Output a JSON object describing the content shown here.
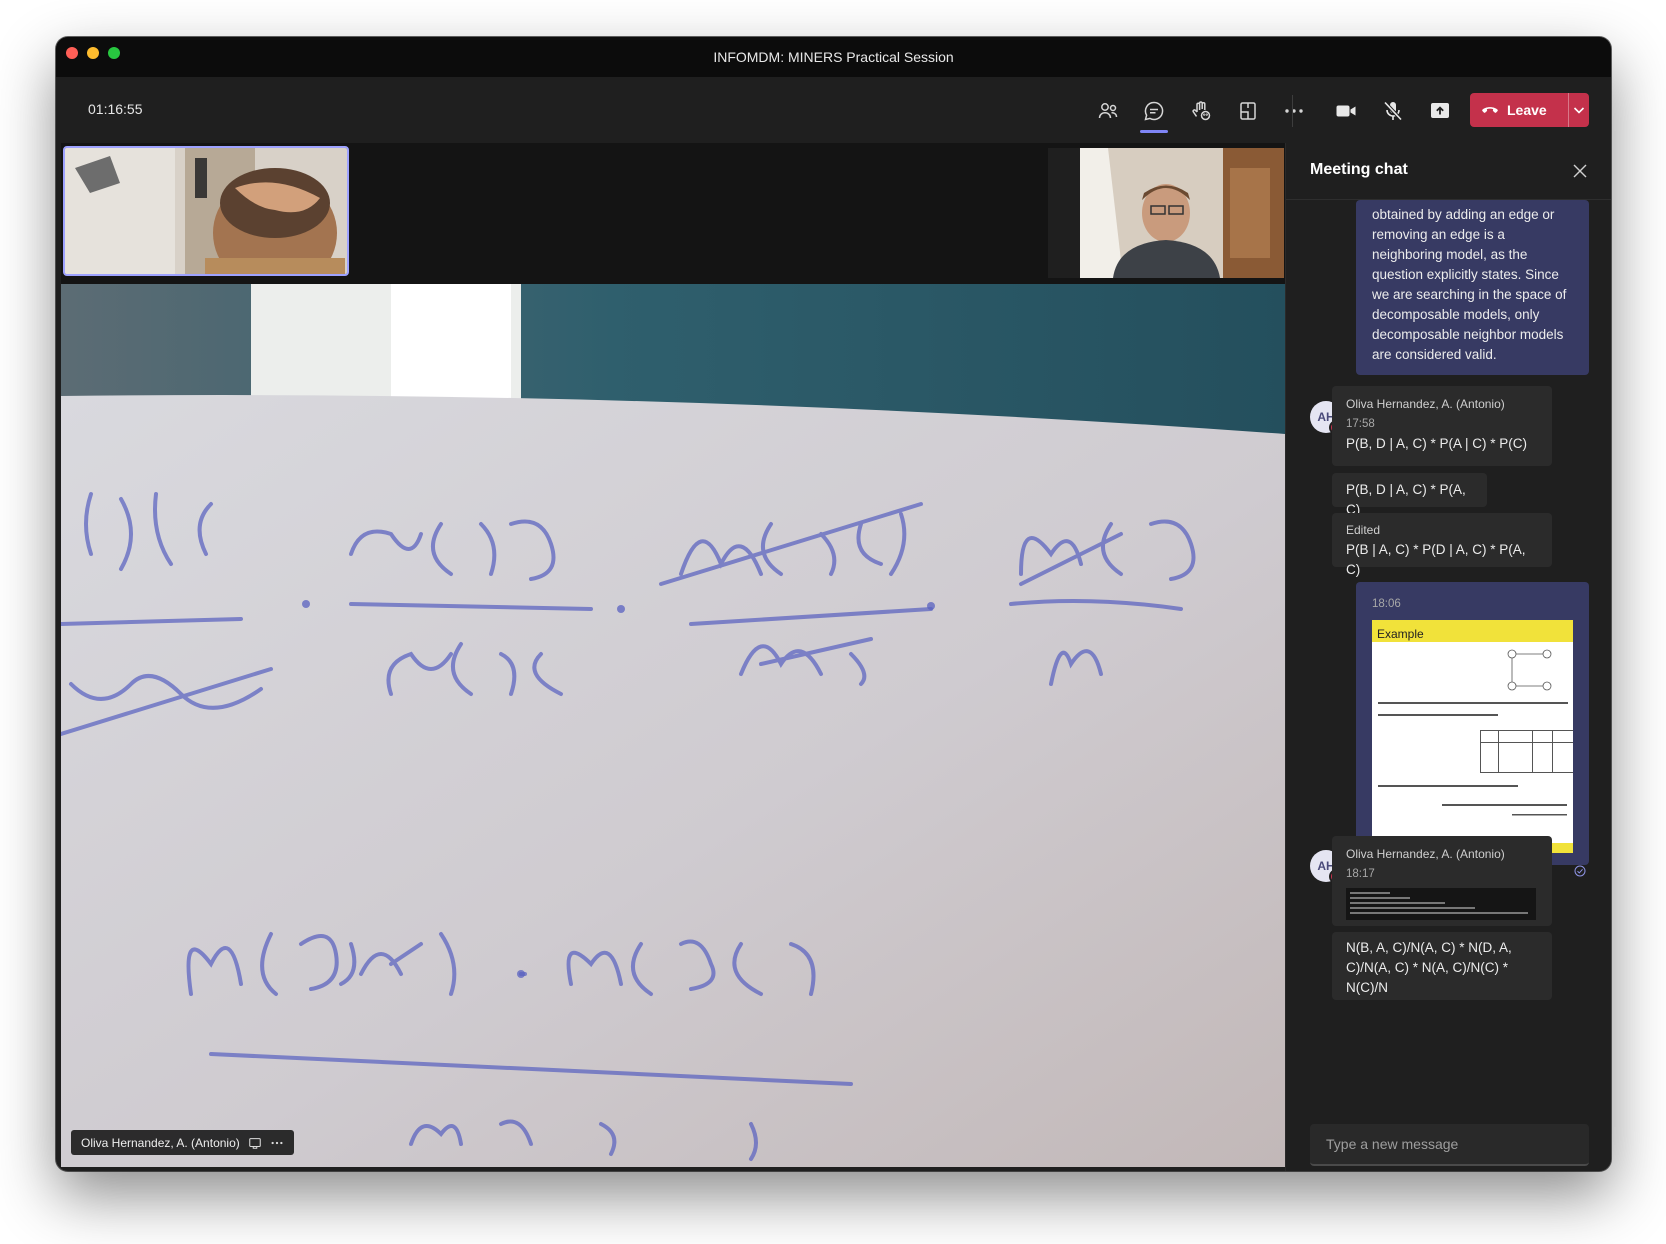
{
  "window": {
    "title": "INFOMDM: MINERS Practical Session"
  },
  "toolbar": {
    "timer": "01:16:55",
    "leave_label": "Leave"
  },
  "main_video": {
    "participant_name": "Oliva Hernandez, A. (Antonio)"
  },
  "chat": {
    "title": "Meeting chat",
    "messages": [
      {
        "from": "me",
        "text": "obtained by adding an edge or removing an edge is a neighboring model, as the question explicitly states. Since we are searching in the space of decomposable models, only decomposable neighbor models are considered valid."
      },
      {
        "from": "other",
        "sender": "Oliva Hernandez, A. (Antonio)",
        "initials": "AH",
        "time": "17:58",
        "lines": [
          "P(B, D | A, C) * P(A | C) * P(C)",
          "P(B, D | A, C) * P(A, C)"
        ],
        "edited_label": "Edited",
        "edited_text": "P(B | A, C) * P(D | A, C) * P(A, C)"
      },
      {
        "from": "me",
        "time": "18:06",
        "slide_title": "Example"
      },
      {
        "from": "other",
        "sender": "Oliva Hernandez, A. (Antonio)",
        "initials": "AH",
        "time": "18:17",
        "text": "N(B, A, C)/N(A, C) * N(D, A, C)/N(A, C) * N(A, C)/N(C) * N(C)/N"
      }
    ],
    "compose_placeholder": "Type a new message"
  },
  "icons": {
    "toolbar": [
      "people-icon",
      "chat-icon",
      "reactions-icon",
      "rooms-icon",
      "more-icon",
      "camera-icon",
      "mic-off-icon",
      "share-icon"
    ],
    "compose": [
      "format-icon",
      "important-icon",
      "attach-icon",
      "emoji-icon",
      "gif-icon",
      "sticker-icon",
      "more-icon",
      "send-icon"
    ]
  },
  "colors": {
    "leave": "#c4314b",
    "accent": "#7f85f5",
    "my_bubble": "#373a63",
    "other_bubble": "#2b2b2b"
  }
}
